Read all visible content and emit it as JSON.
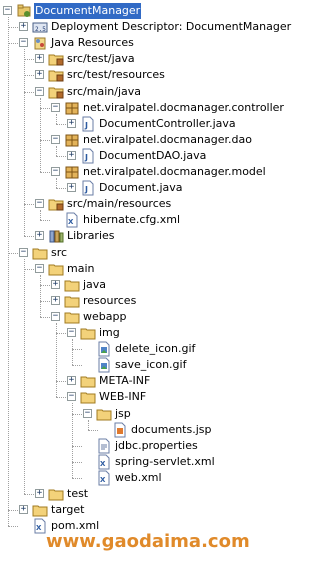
{
  "tree": [
    {
      "label": "DocumentManager",
      "icon": "project-icon",
      "indent": 0,
      "toggle": "-",
      "selected": true
    },
    {
      "label": "Deployment Descriptor: DocumentManager",
      "icon": "deployment-descriptor-icon",
      "indent": 1,
      "toggle": "+"
    },
    {
      "label": "Java Resources",
      "icon": "java-resources-icon",
      "indent": 1,
      "toggle": "-"
    },
    {
      "label": "src/test/java",
      "icon": "source-folder-icon",
      "indent": 2,
      "toggle": "+"
    },
    {
      "label": "src/test/resources",
      "icon": "source-folder-icon",
      "indent": 2,
      "toggle": "+"
    },
    {
      "label": "src/main/java",
      "icon": "source-folder-icon",
      "indent": 2,
      "toggle": "-"
    },
    {
      "label": "net.viralpatel.docmanager.controller",
      "icon": "package-icon",
      "indent": 3,
      "toggle": "-"
    },
    {
      "label": "DocumentController.java",
      "icon": "java-file-icon",
      "indent": 4,
      "toggle": "+"
    },
    {
      "label": "net.viralpatel.docmanager.dao",
      "icon": "package-icon",
      "indent": 3,
      "toggle": "-"
    },
    {
      "label": "DocumentDAO.java",
      "icon": "java-file-icon",
      "indent": 4,
      "toggle": "+"
    },
    {
      "label": "net.viralpatel.docmanager.model",
      "icon": "package-icon",
      "indent": 3,
      "toggle": "-"
    },
    {
      "label": "Document.java",
      "icon": "java-file-icon",
      "indent": 4,
      "toggle": "+"
    },
    {
      "label": "src/main/resources",
      "icon": "source-folder-icon",
      "indent": 2,
      "toggle": "-"
    },
    {
      "label": "hibernate.cfg.xml",
      "icon": "xml-file-icon",
      "indent": 3,
      "toggle": ""
    },
    {
      "label": "Libraries",
      "icon": "libraries-icon",
      "indent": 2,
      "toggle": "+"
    },
    {
      "label": "src",
      "icon": "folder-icon",
      "indent": 1,
      "toggle": "-"
    },
    {
      "label": "main",
      "icon": "folder-icon",
      "indent": 2,
      "toggle": "-"
    },
    {
      "label": "java",
      "icon": "folder-icon",
      "indent": 3,
      "toggle": "+"
    },
    {
      "label": "resources",
      "icon": "folder-icon",
      "indent": 3,
      "toggle": "+"
    },
    {
      "label": "webapp",
      "icon": "folder-icon",
      "indent": 3,
      "toggle": "-"
    },
    {
      "label": "img",
      "icon": "folder-icon",
      "indent": 4,
      "toggle": "-"
    },
    {
      "label": "delete_icon.gif",
      "icon": "image-file-icon",
      "indent": 5,
      "toggle": ""
    },
    {
      "label": "save_icon.gif",
      "icon": "image-file-icon",
      "indent": 5,
      "toggle": ""
    },
    {
      "label": "META-INF",
      "icon": "folder-icon",
      "indent": 4,
      "toggle": "+"
    },
    {
      "label": "WEB-INF",
      "icon": "folder-icon",
      "indent": 4,
      "toggle": "-"
    },
    {
      "label": "jsp",
      "icon": "folder-icon",
      "indent": 5,
      "toggle": "-"
    },
    {
      "label": "documents.jsp",
      "icon": "jsp-file-icon",
      "indent": 6,
      "toggle": ""
    },
    {
      "label": "jdbc.properties",
      "icon": "properties-file-icon",
      "indent": 5,
      "toggle": ""
    },
    {
      "label": "spring-servlet.xml",
      "icon": "xml-file-icon",
      "indent": 5,
      "toggle": ""
    },
    {
      "label": "web.xml",
      "icon": "xml-file-icon",
      "indent": 5,
      "toggle": ""
    },
    {
      "label": "test",
      "icon": "folder-icon",
      "indent": 2,
      "toggle": "+"
    },
    {
      "label": "target",
      "icon": "folder-icon",
      "indent": 1,
      "toggle": "+"
    },
    {
      "label": "pom.xml",
      "icon": "xml-file-icon",
      "indent": 1,
      "toggle": ""
    }
  ],
  "watermark": "www.gaodaima.com"
}
